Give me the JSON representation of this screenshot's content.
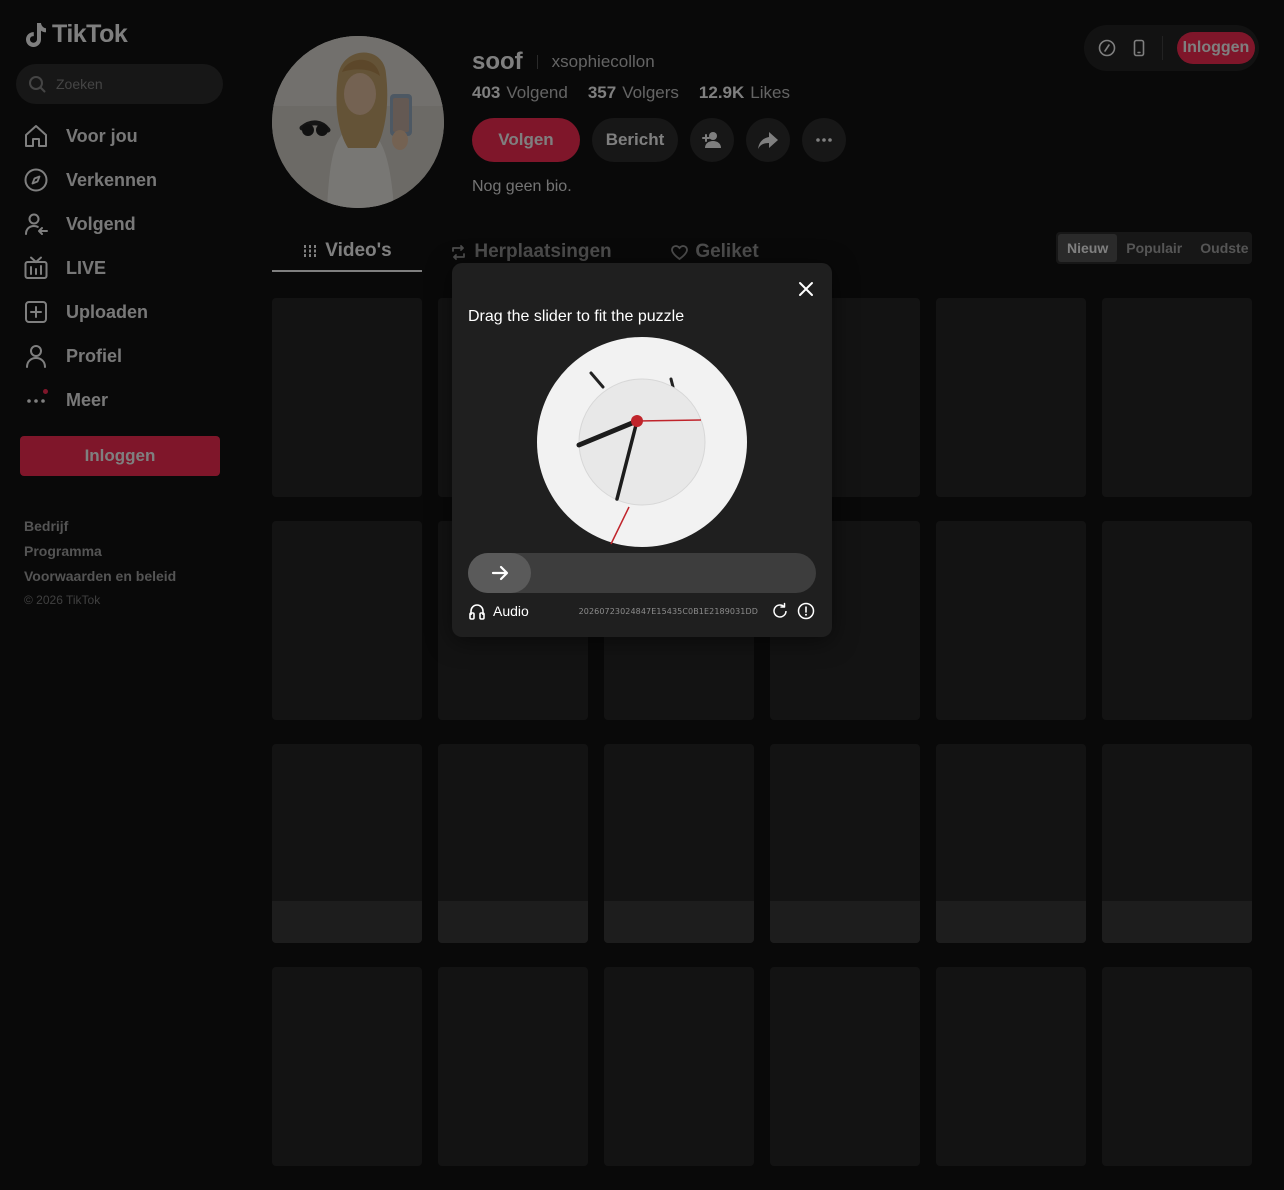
{
  "brand": {
    "name": "TikTok",
    "accent": "#fe2c55"
  },
  "search": {
    "placeholder": "Zoeken"
  },
  "sidebar": {
    "items": [
      {
        "label": "Voor jou",
        "icon": "home-icon"
      },
      {
        "label": "Verkennen",
        "icon": "compass-icon"
      },
      {
        "label": "Volgend",
        "icon": "following-icon"
      },
      {
        "label": "LIVE",
        "icon": "live-tv-icon"
      },
      {
        "label": "Uploaden",
        "icon": "upload-plus-icon"
      },
      {
        "label": "Profiel",
        "icon": "person-icon"
      },
      {
        "label": "Meer",
        "icon": "more-dots-icon"
      }
    ],
    "login_label": "Inloggen",
    "footer": [
      "Bedrijf",
      "Programma",
      "Voorwaarden en beleid"
    ],
    "copyright": "© 2026 TikTok"
  },
  "topbar": {
    "login_label": "Inloggen",
    "icons": [
      "coin-icon",
      "phone-icon"
    ]
  },
  "profile": {
    "display_name": "soof",
    "handle": "xsophiecollon",
    "stats": [
      {
        "value": "403",
        "label": "Volgend"
      },
      {
        "value": "357",
        "label": "Volgers"
      },
      {
        "value": "12.9K",
        "label": "Likes"
      }
    ],
    "follow_label": "Volgen",
    "message_label": "Bericht",
    "bio": "Nog geen bio."
  },
  "tabs": [
    {
      "label": "Video's",
      "icon": "grid-bars-icon",
      "active": true
    },
    {
      "label": "Herplaatsingen",
      "icon": "repost-icon",
      "active": false
    },
    {
      "label": "Geliket",
      "icon": "heart-icon",
      "active": false
    }
  ],
  "sort": [
    {
      "label": "Nieuw",
      "active": true
    },
    {
      "label": "Populair",
      "active": false
    },
    {
      "label": "Oudste",
      "active": false
    }
  ],
  "captcha": {
    "title": "Drag the slider to fit the puzzle",
    "audio_label": "Audio",
    "id": "20260723024847E15435C0B1E2189031DD",
    "slider_progress": 0
  }
}
